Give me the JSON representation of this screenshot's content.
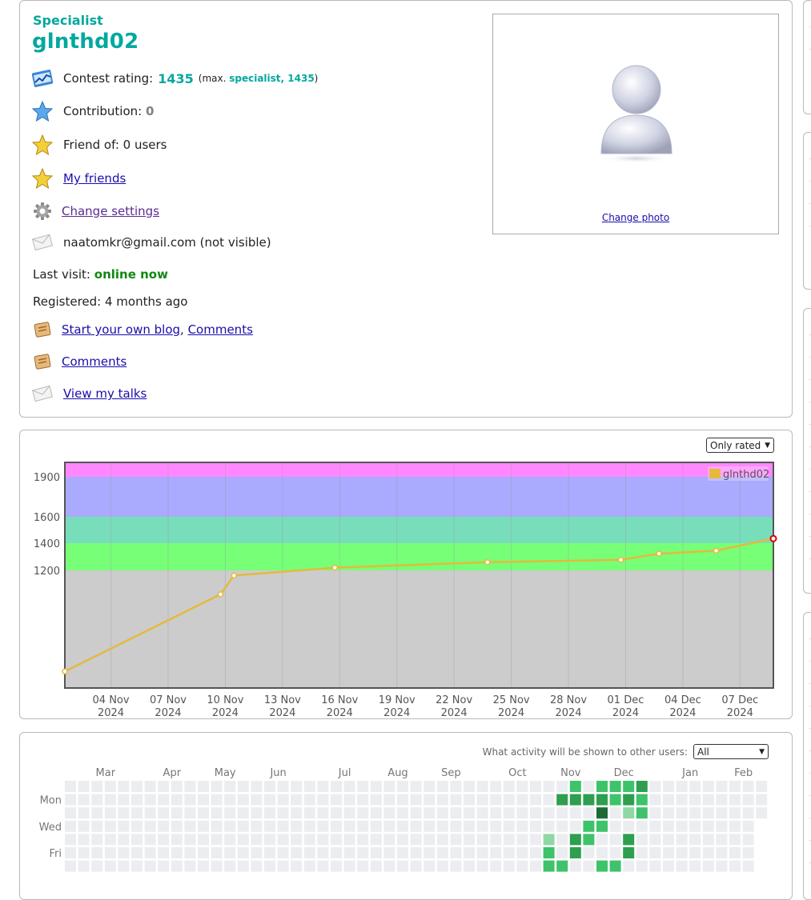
{
  "profile": {
    "rank": "Specialist",
    "handle": "glnthd02",
    "contest_rating_label": "Contest rating:",
    "contest_rating_value": "1435",
    "max_prefix": "(max.",
    "max_rank_value": "specialist, 1435",
    "max_suffix": ")",
    "contribution_label": "Contribution:",
    "contribution_value": "0",
    "friend_of": "Friend of: 0 users",
    "my_friends": "My friends",
    "change_settings": "Change settings",
    "email": "naatomkr@gmail.com (not visible)",
    "last_visit_label": "Last visit:",
    "last_visit_value": "online now",
    "registered": "Registered: 4 months ago",
    "start_blog": "Start your own blog",
    "comma": ",",
    "comments_1": "Comments",
    "comments_2": "Comments",
    "view_talks": "View my talks",
    "change_photo": "Change photo"
  },
  "rating_graph": {
    "filter_value": "Only rated",
    "legend": "glnthd02",
    "colors": {
      "line": "#e6b93c",
      "band_gray": "#cccccc",
      "band_green": "#77ff77",
      "band_cyan": "#77ddbb",
      "band_blue": "#aaaaff",
      "band_violet": "#ff88ff",
      "last_point": "#dd0000"
    }
  },
  "chart_data": {
    "type": "line",
    "y_ticks": [
      1200,
      1400,
      1600,
      1900
    ],
    "bands": [
      {
        "from": 0,
        "to": 1200,
        "color": "#cccccc"
      },
      {
        "from": 1200,
        "to": 1400,
        "color": "#77ff77"
      },
      {
        "from": 1400,
        "to": 1600,
        "color": "#77ddbb"
      },
      {
        "from": 1600,
        "to": 1900,
        "color": "#aaaaff"
      },
      {
        "from": 1900,
        "to": 2000,
        "color": "#ff88ff"
      }
    ],
    "x_ticks": [
      [
        "04 Nov",
        "2024"
      ],
      [
        "07 Nov",
        "2024"
      ],
      [
        "10 Nov",
        "2024"
      ],
      [
        "13 Nov",
        "2024"
      ],
      [
        "16 Nov",
        "2024"
      ],
      [
        "19 Nov",
        "2024"
      ],
      [
        "22 Nov",
        "2024"
      ],
      [
        "25 Nov",
        "2024"
      ],
      [
        "28 Nov",
        "2024"
      ],
      [
        "01 Dec",
        "2024"
      ],
      [
        "04 Dec",
        "2024"
      ],
      [
        "07 Dec",
        "2024"
      ]
    ],
    "series": [
      {
        "name": "glnthd02",
        "points": [
          {
            "date": "2024-11-01 14:00",
            "rating": 312
          },
          {
            "date": "2024-11-09 18:00",
            "rating": 990
          },
          {
            "date": "2024-11-10 11:00",
            "rating": 1155
          },
          {
            "date": "2024-11-15 18:00",
            "rating": 1220
          },
          {
            "date": "2024-11-23 18:00",
            "rating": 1260
          },
          {
            "date": "2024-11-30 18:00",
            "rating": 1278
          },
          {
            "date": "2024-12-02 18:00",
            "rating": 1323
          },
          {
            "date": "2024-12-05 18:00",
            "rating": 1345
          },
          {
            "date": "2024-12-08 18:00",
            "rating": 1435
          }
        ]
      }
    ]
  },
  "activity": {
    "visibility_label": "What activity will be shown to other users:",
    "visibility_value": "All",
    "months": [
      "Mar",
      "Apr",
      "May",
      "Jun",
      "Jul",
      "Aug",
      "Sep",
      "Oct",
      "Nov",
      "Dec",
      "Jan",
      "Feb"
    ],
    "day_labels": [
      "Mon",
      "Wed",
      "Fri"
    ],
    "empty_color": "#ebedf0",
    "level_colors": [
      "#ebedf0",
      "#8fd8a6",
      "#3ec36a",
      "#2e9e4f",
      "#1d6b34"
    ],
    "active_cells": [
      {
        "week": 36,
        "day": 0,
        "level": 0
      },
      {
        "week": 36,
        "day": 4,
        "level": 1
      },
      {
        "week": 36,
        "day": 5,
        "level": 2
      },
      {
        "week": 36,
        "day": 6,
        "level": 2
      },
      {
        "week": 37,
        "day": 1,
        "level": 3
      },
      {
        "week": 37,
        "day": 6,
        "level": 2
      },
      {
        "week": 38,
        "day": 0,
        "level": 2
      },
      {
        "week": 38,
        "day": 1,
        "level": 3
      },
      {
        "week": 38,
        "day": 4,
        "level": 3
      },
      {
        "week": 38,
        "day": 5,
        "level": 3
      },
      {
        "week": 39,
        "day": 1,
        "level": 3
      },
      {
        "week": 39,
        "day": 3,
        "level": 2
      },
      {
        "week": 39,
        "day": 4,
        "level": 2
      },
      {
        "week": 40,
        "day": 0,
        "level": 2
      },
      {
        "week": 40,
        "day": 1,
        "level": 3
      },
      {
        "week": 40,
        "day": 2,
        "level": 4
      },
      {
        "week": 40,
        "day": 3,
        "level": 2
      },
      {
        "week": 40,
        "day": 6,
        "level": 2
      },
      {
        "week": 41,
        "day": 0,
        "level": 2
      },
      {
        "week": 41,
        "day": 1,
        "level": 2
      },
      {
        "week": 41,
        "day": 6,
        "level": 2
      },
      {
        "week": 42,
        "day": 0,
        "level": 2
      },
      {
        "week": 42,
        "day": 1,
        "level": 3
      },
      {
        "week": 42,
        "day": 2,
        "level": 1
      },
      {
        "week": 42,
        "day": 4,
        "level": 3
      },
      {
        "week": 42,
        "day": 5,
        "level": 3
      },
      {
        "week": 43,
        "day": 0,
        "level": 3
      },
      {
        "week": 43,
        "day": 1,
        "level": 2
      },
      {
        "week": 43,
        "day": 2,
        "level": 2
      }
    ]
  }
}
